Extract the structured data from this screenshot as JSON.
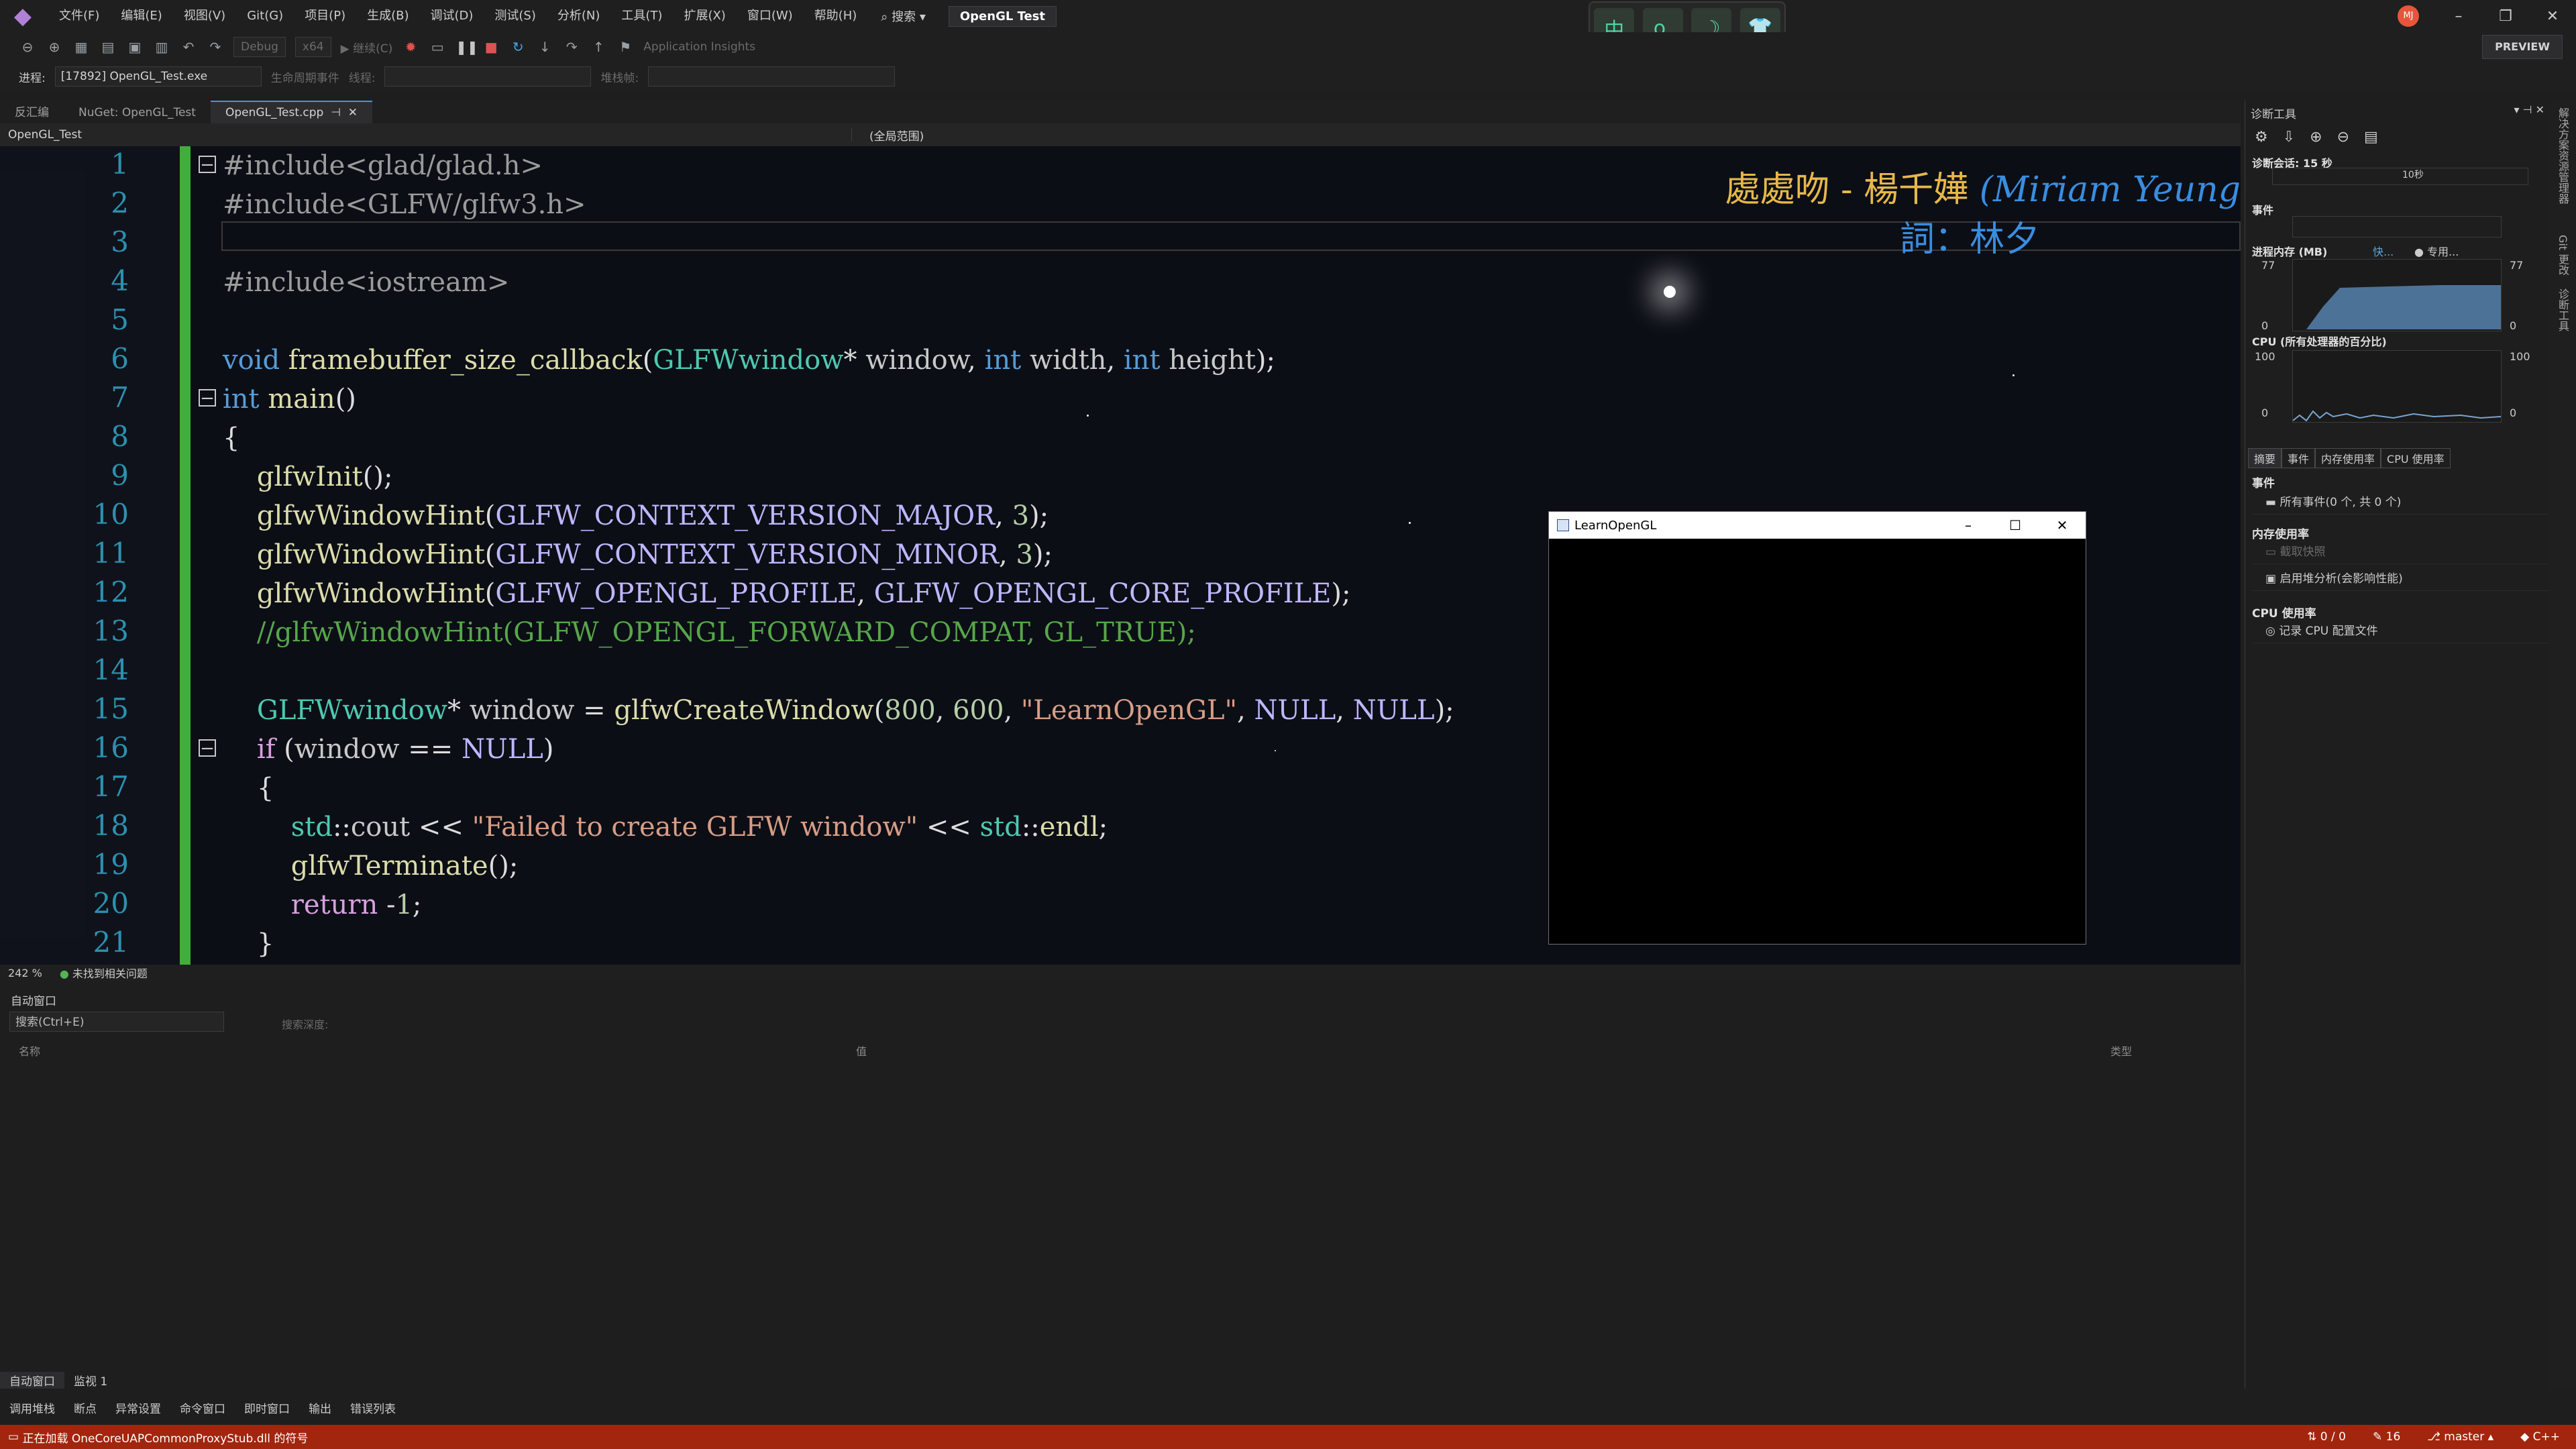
{
  "menu": {
    "items": [
      "文件(F)",
      "编辑(E)",
      "视图(V)",
      "Git(G)",
      "项目(P)",
      "生成(B)",
      "调试(D)",
      "测试(S)",
      "分析(N)",
      "工具(T)",
      "扩展(X)",
      "窗口(W)",
      "帮助(H)"
    ],
    "search": "搜索",
    "solution": "OpenGL Test",
    "avatar": "MJ",
    "ime": [
      "中",
      "o,",
      "☽",
      "👕"
    ]
  },
  "toolbar": {
    "config": "Debug",
    "platform": "x64",
    "continue": "继续(C)",
    "insights": "Application Insights",
    "preview": "PREVIEW"
  },
  "procbar": {
    "process_label": "进程:",
    "process_value": "[17892] OpenGL_Test.exe",
    "lifecycle": "生命周期事件",
    "thread_label": "线程:",
    "stack_label": "堆栈帧:"
  },
  "doc_tabs": [
    "反汇编",
    "NuGet: OpenGL_Test",
    "OpenGL_Test.cpp"
  ],
  "nav": {
    "project": "OpenGL_Test",
    "scope": "(全局范围)"
  },
  "editor": {
    "line_numbers": [
      "1",
      "2",
      "3",
      "4",
      "5",
      "6",
      "7",
      "8",
      "9",
      "10",
      "11",
      "12",
      "13",
      "14",
      "15",
      "16",
      "17",
      "18",
      "19",
      "20",
      "21"
    ],
    "lyric_line1_cjk": "處處吻 - 楊千嬅",
    "lyric_line1_latin": "(Miriam Yeung",
    "lyric_line2": "詞：林夕"
  },
  "editor_status": {
    "zoom": "242 %",
    "issues": "未找到相关问题"
  },
  "autos": {
    "title": "自动窗口",
    "search_placeholder": "搜索(Ctrl+E)",
    "search_depth": "搜索深度:",
    "col_name": "名称",
    "col_value": "值",
    "col_type": "类型"
  },
  "bottom_tabs": [
    "自动窗口",
    "监视 1"
  ],
  "tool_tabs": [
    "调用堆栈",
    "断点",
    "异常设置",
    "命令窗口",
    "即时窗口",
    "输出",
    "错误列表"
  ],
  "status": {
    "message": "正在加载 OneCoreUAPCommonProxyStub.dll 的符号",
    "sync": "0 / 0",
    "edits": "16",
    "branch": "master",
    "lang": "C++"
  },
  "diag": {
    "title": "诊断工具",
    "session": "诊断会话: 15 秒",
    "ten_sec": "10秒",
    "events": "事件",
    "memory_title": "进程内存 (MB)",
    "memory_legend_a": "快...",
    "memory_legend_b": "专用...",
    "mem_max": "77",
    "mem_min": "0",
    "cpu_title": "CPU (所有处理器的百分比)",
    "cpu_max": "100",
    "cpu_min": "0",
    "tabs": [
      "摘要",
      "事件",
      "内存使用率",
      "CPU 使用率"
    ],
    "sec_events": "事件",
    "all_events": "所有事件(0 个, 共 0 个)",
    "sec_memory": "内存使用率",
    "snapshot": "截取快照",
    "heap": "启用堆分析(会影响性能)",
    "sec_cpu": "CPU 使用率",
    "record_cpu": "记录 CPU 配置文件"
  },
  "side_rail": [
    "解决方案资源管理器",
    "Git 更改",
    "诊断工具"
  ],
  "gl_window": {
    "title": "LearnOpenGL"
  },
  "colors": {
    "status_bar": "#a1260d",
    "change_bar": "#3fae3a",
    "line_number": "#2b91af"
  }
}
